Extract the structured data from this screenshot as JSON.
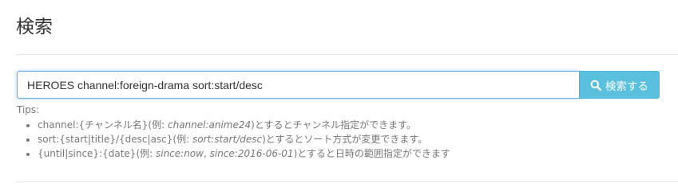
{
  "page": {
    "title": "検索"
  },
  "search": {
    "value": "HEROES channel:foreign-drama sort:start/desc",
    "button_label": "検索する",
    "button_icon": "search-icon"
  },
  "tips": {
    "label": "Tips:",
    "items": [
      {
        "pre": "channel:{チャンネル名}(例: ",
        "ex1": "channel:anime24",
        "mid": "",
        "ex2": "",
        "post": ")とするとチャンネル指定ができます。"
      },
      {
        "pre": "sort:{start|title}/{desc|asc}(例: ",
        "ex1": "sort:start/desc",
        "mid": "",
        "ex2": "",
        "post": ")とするとソート方式が変更できます。"
      },
      {
        "pre": "{until|since}:{date}(例: ",
        "ex1": "since:now",
        "mid": ", ",
        "ex2": "since:2016-06-01",
        "post": ")とすると日時の範囲指定ができます"
      }
    ]
  },
  "colors": {
    "button_bg": "#5bc0de",
    "input_focus_border": "#66afe9",
    "tips_text": "#777777"
  }
}
